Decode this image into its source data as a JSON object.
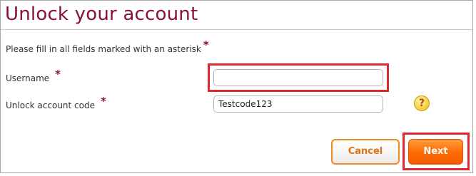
{
  "form": {
    "title": "Unlock your account",
    "instructions": "Please fill in all fields marked with an asterisk",
    "required_marker": "*",
    "username": {
      "label": "Username",
      "value": "",
      "placeholder": ""
    },
    "unlock_code": {
      "label": "Unlock account code",
      "value": "Testcode123",
      "placeholder": ""
    },
    "help_glyph": "?"
  },
  "actions": {
    "cancel_label": "Cancel",
    "next_label": "Next"
  },
  "icons": {
    "help": "help-question-icon"
  },
  "colors": {
    "title": "#8a0f3c",
    "asterisk": "#8a0f3c",
    "highlight_box": "#e0262f",
    "accent_orange": "#ff6a00",
    "cancel_text": "#e07010"
  }
}
